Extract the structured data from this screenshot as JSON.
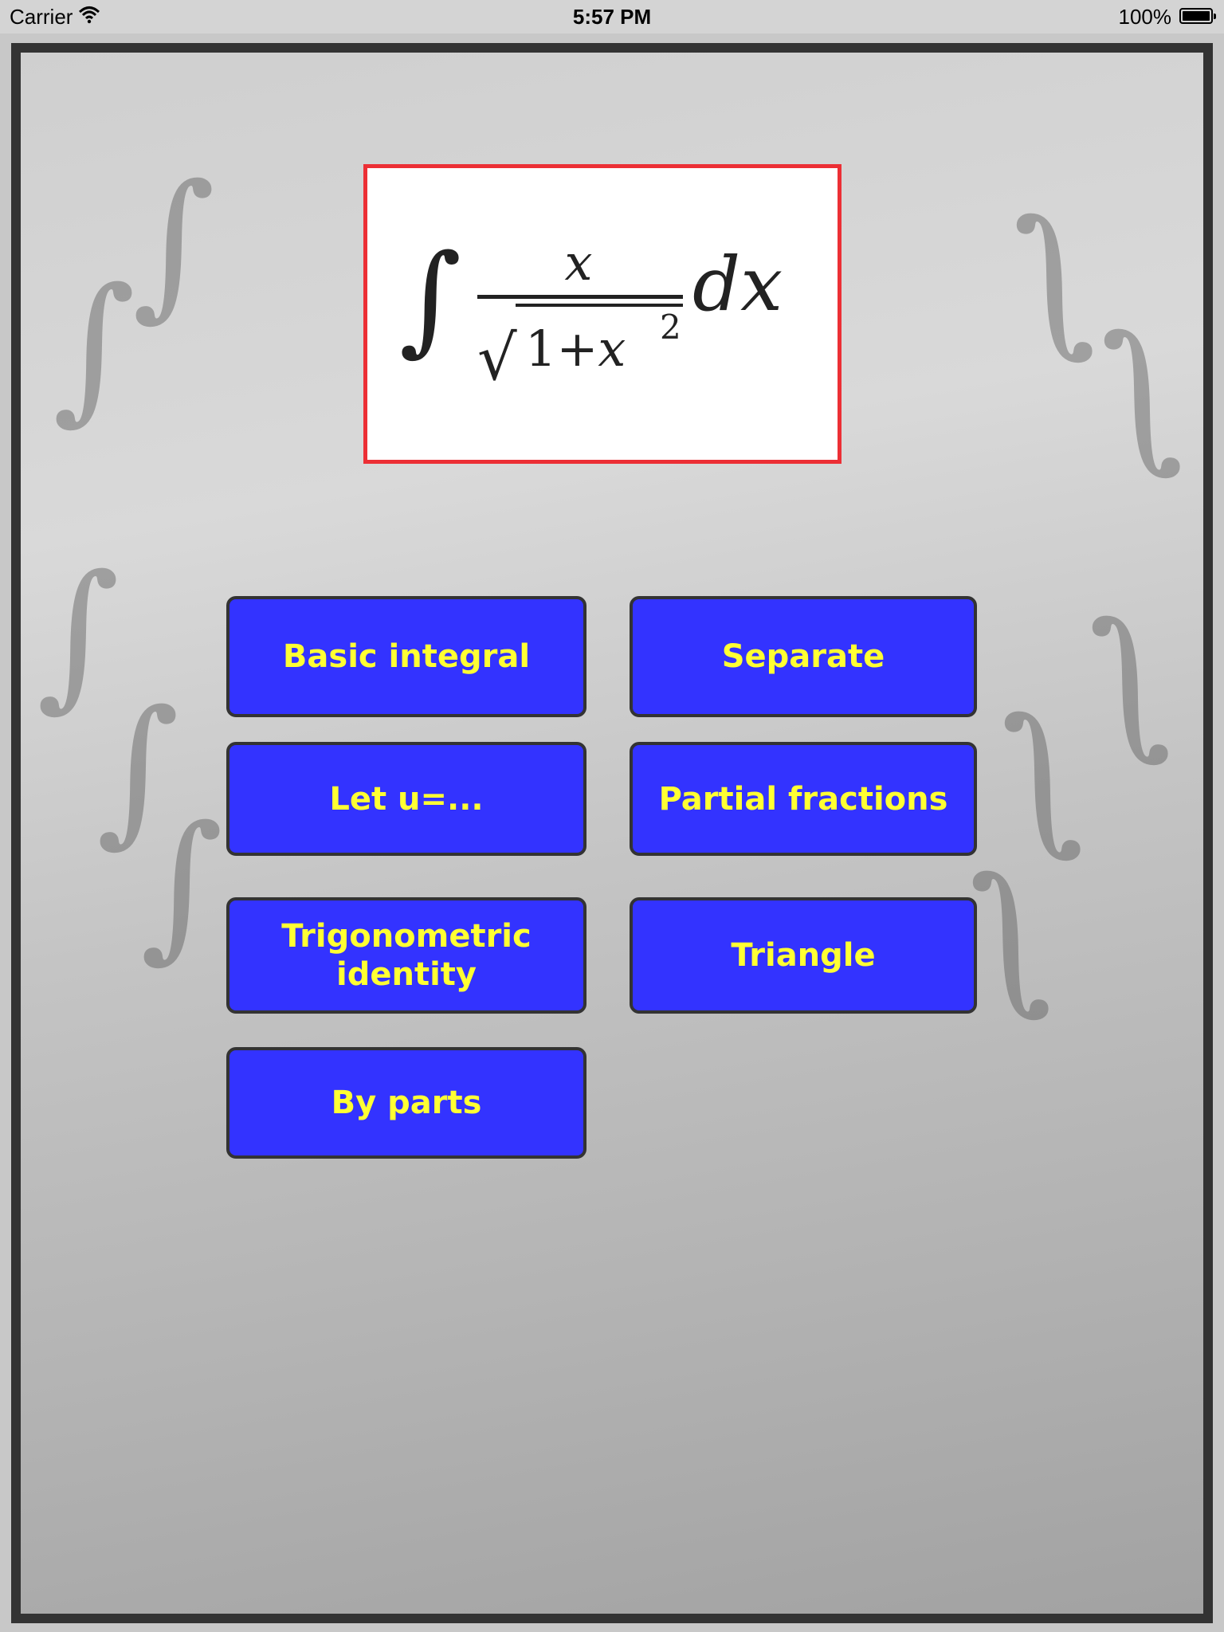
{
  "status_bar": {
    "carrier": "Carrier",
    "time": "5:57 PM",
    "battery": "100%"
  },
  "formula": {
    "integral_sign": "∫",
    "numerator": "x",
    "radical": "√",
    "denominator_one": "1+",
    "denominator_x": "x",
    "exponent": "2",
    "differential": "dx"
  },
  "buttons": {
    "basic_integral": "Basic integral",
    "separate": "Separate",
    "let_u": "Let u=...",
    "partial_fractions": "Partial fractions",
    "trig_line1": "Trigonometric",
    "trig_line2": "identity",
    "triangle": "Triangle",
    "by_parts": "By parts"
  },
  "colors": {
    "button_fill": "#3333ff",
    "button_text": "#ffff33",
    "formula_border": "#ec2f35",
    "frame_border": "#333333"
  }
}
